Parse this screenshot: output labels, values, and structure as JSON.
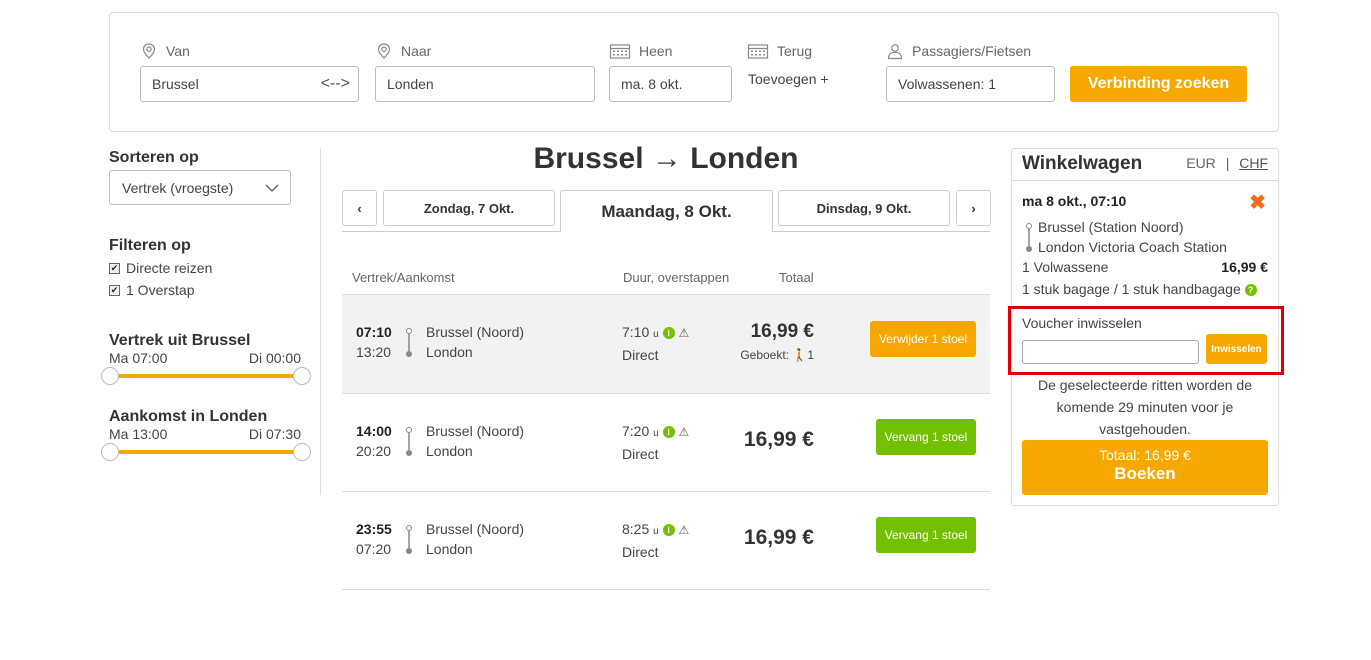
{
  "search": {
    "from_label": "Van",
    "from_value": "Brussel",
    "to_label": "Naar",
    "to_value": "Londen",
    "depart_label": "Heen",
    "depart_value": "ma. 8 okt.",
    "return_label": "Terug",
    "return_add": "Toevoegen +",
    "pax_label": "Passagiers/Fietsen",
    "pax_value": "Volwassenen: 1",
    "submit_label": "Verbinding zoeken",
    "swap_glyph": "<-->"
  },
  "sidebar": {
    "sort_title": "Sorteren op",
    "sort_value": "Vertrek (vroegste)",
    "filter_title": "Filteren op",
    "filters": [
      {
        "label": "Directe reizen",
        "checked": true
      },
      {
        "label": "1 Overstap",
        "checked": true
      }
    ],
    "departure": {
      "title": "Vertrek uit Brussel",
      "min": "Ma 07:00",
      "max": "Di 00:00"
    },
    "arrival": {
      "title": "Aankomst in Londen",
      "min": "Ma 13:00",
      "max": "Di 07:30"
    }
  },
  "route": {
    "title": "Brussel → Londen",
    "prev_glyph": "‹",
    "next_glyph": "›",
    "prev_day": "Zondag, 7 Okt.",
    "current_day": "Maandag, 8 Okt.",
    "next_day": "Dinsdag, 9 Okt."
  },
  "table": {
    "col_departure_arrival": "Vertrek/Aankomst",
    "col_duration": "Duur, overstappen",
    "col_total": "Totaal",
    "rows": [
      {
        "dep": "07:10",
        "arr": "13:20",
        "from": "Brussel (Noord)",
        "to": "London",
        "duration": "7:10",
        "unit": "u",
        "type": "Direct",
        "price": "16,99 €",
        "booked": "Geboekt:",
        "booked_count": "1",
        "action": "Verwijder 1 stoel"
      },
      {
        "dep": "14:00",
        "arr": "20:20",
        "from": "Brussel (Noord)",
        "to": "London",
        "duration": "7:20",
        "unit": "u",
        "type": "Direct",
        "price": "16,99 €",
        "action": "Vervang 1 stoel"
      },
      {
        "dep": "23:55",
        "arr": "07:20",
        "from": "Brussel (Noord)",
        "to": "London",
        "duration": "8:25",
        "unit": "u",
        "type": "Direct",
        "price": "16,99 €",
        "action": "Vervang 1 stoel"
      }
    ]
  },
  "cart": {
    "title": "Winkelwagen",
    "currency_eur": "EUR",
    "currency_sep": "|",
    "currency_chf": "CHF",
    "trip_date": "ma 8 okt., 07:10",
    "from": "Brussel (Station Noord)",
    "to": "London Victoria Coach Station",
    "pax": "1 Volwassene",
    "pax_price": "16,99 €",
    "luggage": "1 stuk bagage / 1 stuk handbagage",
    "voucher_label": "Voucher inwisselen",
    "voucher_button": "Inwisselen",
    "hold_note": "De geselecteerde ritten worden de komende 29 minuten voor je vastgehouden.",
    "total": "Totaal: 16,99 €",
    "book": "Boeken"
  },
  "colors": {
    "accent": "#f7a800",
    "green": "#73c000",
    "remove": "#f26a1b",
    "highlight_border": "#e10000"
  }
}
